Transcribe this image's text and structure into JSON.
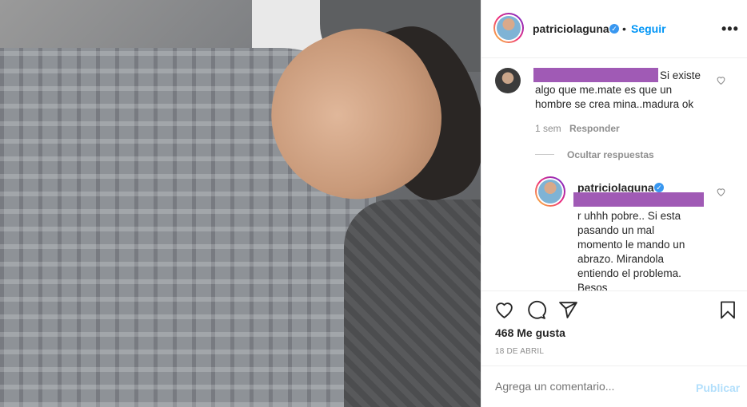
{
  "post": {
    "author": "patriciolaguna",
    "dot": "•",
    "follow_label": "Seguir",
    "more_label": "•••"
  },
  "comments": [
    {
      "text_line1": "Si existe",
      "text_line2": "algo que me.mate es que un",
      "text_line3": "hombre se crea mina..madura ok",
      "time": "1 sem",
      "reply_label": "Responder",
      "hide_replies_label": "Ocultar respuestas"
    }
  ],
  "reply": {
    "author": "patriciolaguna",
    "lines": [
      "r uhhh pobre.. Si esta",
      "pasando un mal",
      "momento le mando un",
      "abrazo. Mirandola",
      "entiendo el problema.",
      "Besos"
    ]
  },
  "likes": "468 Me gusta",
  "date": "18 DE ABRIL",
  "add_comment": {
    "placeholder": "Agrega un comentario...",
    "publish_label": "Publicar"
  },
  "colors": {
    "accent": "#0095f6",
    "redaction": "#a05ab5",
    "publish_disabled": "#b2dffc"
  },
  "icons": [
    "heart-icon",
    "comment-icon",
    "share-icon",
    "bookmark-icon",
    "verified-icon",
    "more-options-icon"
  ]
}
